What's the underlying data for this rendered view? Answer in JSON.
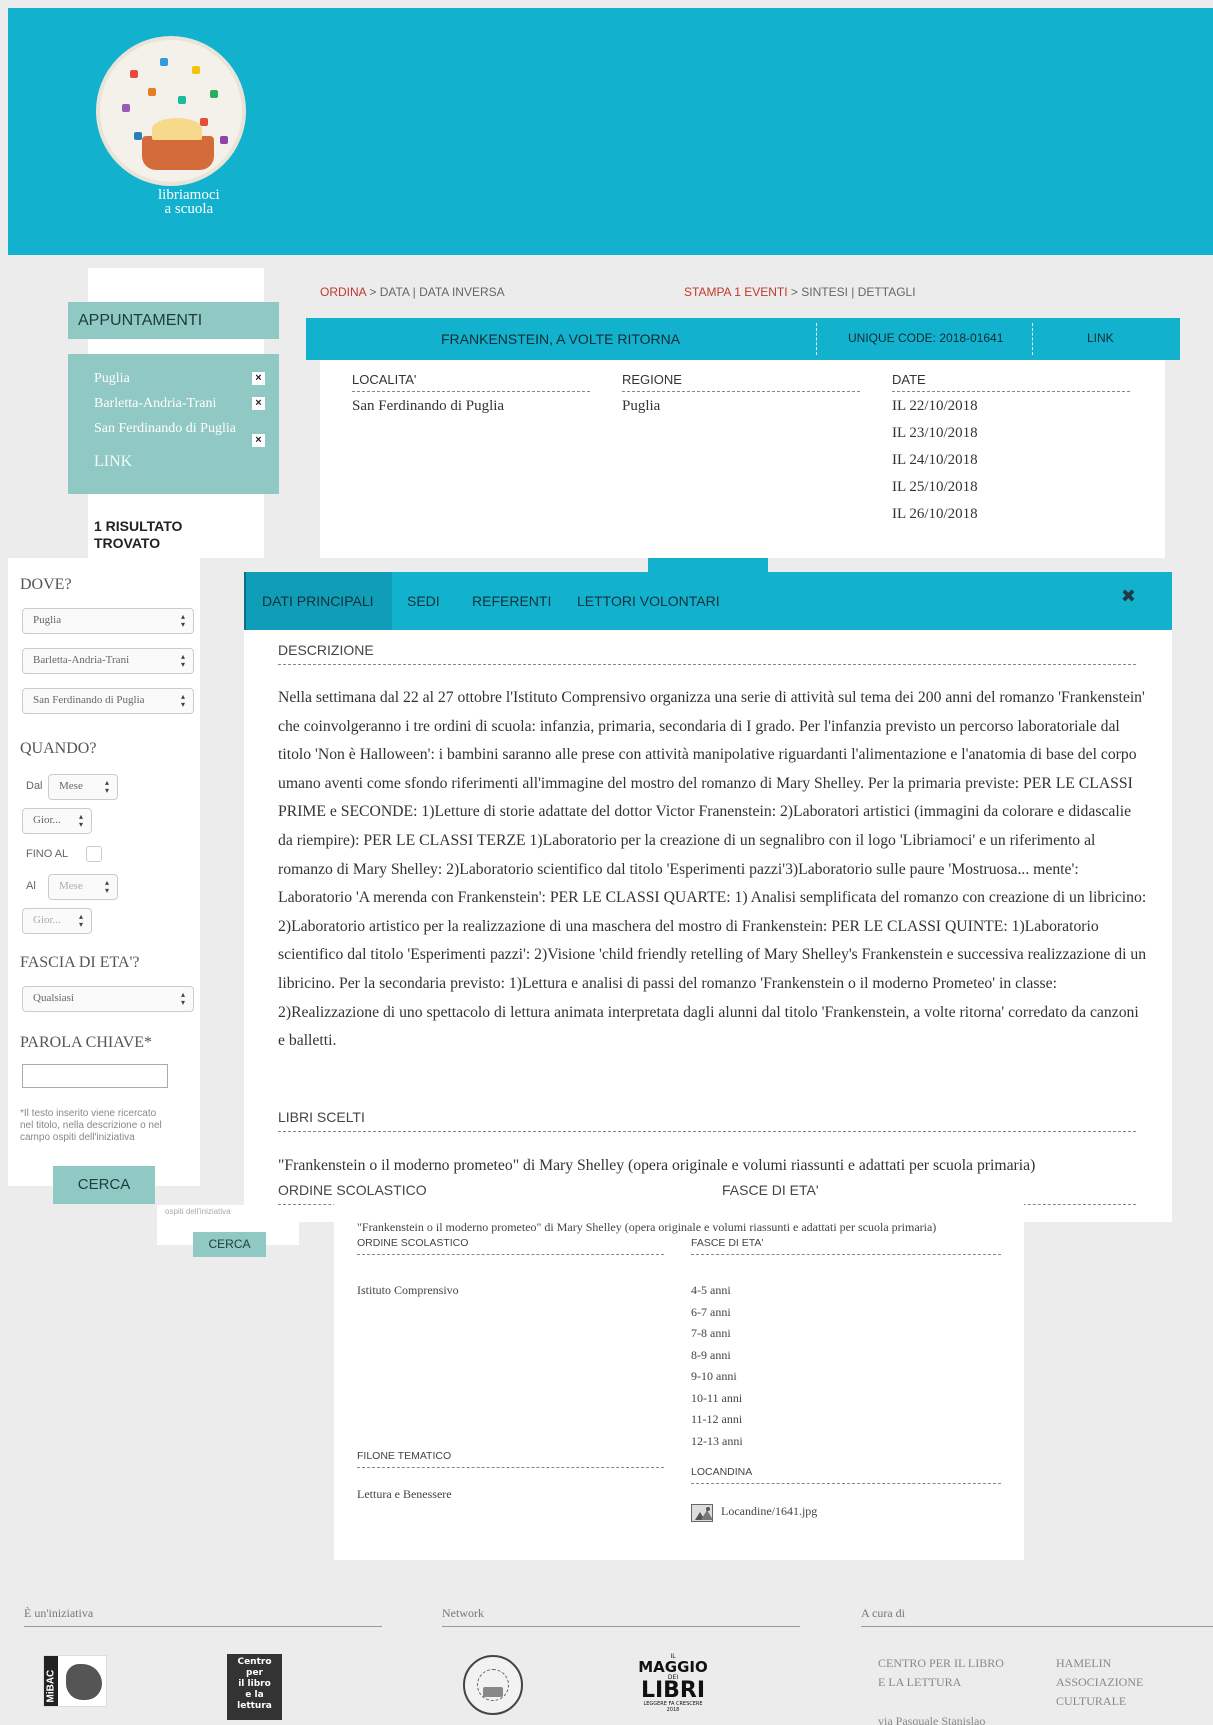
{
  "header": {
    "logo_text_line1": "libriamoci",
    "logo_text_line2": "a scuola"
  },
  "left_panel": {
    "appointments_title": "APPUNTAMENTI",
    "filters": [
      "Puglia",
      "Barletta-Andria-Trani",
      "San Ferdinando di Puglia"
    ],
    "filter_remove_icon": "×",
    "link_label": "LINK",
    "result_line1": "1 RISULTATO",
    "result_line2": "TROVATO"
  },
  "toolbar": {
    "order_label": "ORDINA",
    "order_sep": " > ",
    "order_date": "DATA",
    "order_divider": " | ",
    "order_reverse": "DATA INVERSA",
    "print_label": "STAMPA 1 EVENTI",
    "print_sep": " > ",
    "print_summary": "SINTESI",
    "print_divider": " | ",
    "print_details": "DETTAGLI"
  },
  "event": {
    "title": "FRANKENSTEIN, A VOLTE RITORNA",
    "unique_code": "UNIQUE CODE: 2018-01641",
    "link": "LINK",
    "location_header": "LOCALITA'",
    "location_value": "San Ferdinando di Puglia",
    "region_header": "REGIONE",
    "region_value": "Puglia",
    "dates_header": "DATE",
    "dates": [
      "IL 22/10/2018",
      "IL 23/10/2018",
      "IL 24/10/2018",
      "IL 25/10/2018",
      "IL 26/10/2018"
    ]
  },
  "sidebar": {
    "where_title": "DOVE?",
    "region_select": "Puglia",
    "province_select": "Barletta-Andria-Trani",
    "city_select": "San Ferdinando di Puglia",
    "when_title": "QUANDO?",
    "from_label": "Dal",
    "month_placeholder": "Mese",
    "day_placeholder": "Gior...",
    "until_label": "FINO AL",
    "to_label": "Al",
    "month_placeholder_2": "Mese",
    "day_placeholder_2": "Gior...",
    "age_title": "FASCIA DI ETA'?",
    "age_select": "Qualsiasi",
    "keyword_title": "PAROLA CHIAVE*",
    "keyword_note": "*Il testo inserito viene ricercato nel titolo, nella descrizione o nel campo ospiti dell'iniziativa",
    "search_button": "CERCA"
  },
  "detail": {
    "tabs": [
      "DATI PRINCIPALI",
      "SEDI",
      "REFERENTI",
      "LETTORI VOLONTARI"
    ],
    "close_icon": "✖",
    "description_header": "DESCRIZIONE",
    "description": "Nella settimana dal 22 al 27 ottobre l'Istituto Comprensivo organizza una serie di attività sul tema dei 200 anni del romanzo 'Frankenstein' che coinvolgeranno i tre ordini di scuola: infanzia, primaria, secondaria di I grado. Per l'infanzia previsto un percorso laboratoriale dal titolo 'Non è Halloween': i bambini saranno alle prese con attività manipolative riguardanti l'alimentazione e l'anatomia di base del corpo umano aventi come sfondo riferimenti all'immagine del mostro del romanzo di Mary Shelley. Per la primaria previste: PER LE CLASSI PRIME e SECONDE: 1)Letture di storie adattate del dottor Victor Franenstein: 2)Laboratori artistici (immagini da colorare e didascalie da riempire): PER LE CLASSI TERZE 1)Laboratorio per la creazione di un segnalibro con il logo 'Libriamoci' e un riferimento al romanzo di Mary Shelley: 2)Laboratorio scientifico dal titolo 'Esperimenti pazzi'3)Laboratorio sulle paure 'Mostruosa... mente': Laboratorio 'A merenda con Frankenstein': PER LE CLASSI QUARTE: 1) Analisi semplificata del romanzo con creazione di un libricino: 2)Laboratorio artistico per la realizzazione di una maschera del mostro di Frankenstein: PER LE CLASSI QUINTE: 1)Laboratorio scientifico dal titolo 'Esperimenti pazzi': 2)Visione 'child friendly retelling of Mary Shelley's Frankenstein e successiva realizzazione di un libricino. Per la secondaria previsto: 1)Lettura e analisi di passi del romanzo 'Frankenstein o il moderno Prometeo' in classe: 2)Realizzazione di uno spettacolo di lettura animata interpretata dagli alunni dal titolo 'Frankenstein, a volte ritorna' corredato da canzoni e balletti.",
    "books_header": "LIBRI SCELTI",
    "books_value": "\"Frankenstein o il moderno prometeo\" di Mary Shelley (opera originale e volumi riassunti e adattati per scuola primaria)",
    "school_order_header": "ORDINE SCOLASTICO",
    "age_ranges_header": "FASCE DI ETA'"
  },
  "lower": {
    "keyword_note_fragment": "ospiti dell'iniziativa",
    "search_button": "CERCA",
    "books_value": "\"Frankenstein o il moderno prometeo\" di Mary Shelley (opera originale e volumi riassunti e adattati per scuola primaria)",
    "school_order_header": "ORDINE SCOLASTICO",
    "school_order_value": "Istituto Comprensivo",
    "age_ranges_header": "FASCE DI ETA'",
    "age_ranges": [
      "4-5 anni",
      "6-7 anni",
      "7-8 anni",
      "8-9 anni",
      "9-10 anni",
      "10-11 anni",
      "11-12 anni",
      "12-13 anni"
    ],
    "theme_header": "FILONE TEMATICO",
    "theme_value": "Lettura e Benessere",
    "poster_header": "LOCANDINA",
    "poster_file": "Locandine/1641.jpg"
  },
  "footer": {
    "col1_title": "È un'iniziativa",
    "col2_title": "Network",
    "col3_title": "A cura di",
    "mibac_text": "MiBAC",
    "cepell_lines": [
      "Centro",
      "per",
      "il libro",
      "e la",
      "lettura"
    ],
    "maggio_top": "IL",
    "maggio_line1": "MAGGIO",
    "maggio_mid": "DEI",
    "maggio_line2": "LIBRI",
    "maggio_sub": "LEGGERE FA CRESCERE",
    "maggio_year": "2018",
    "org1": "CENTRO PER IL LIBRO E LA LETTURA",
    "org1_addr": "via Pasquale Stanislao",
    "org2": "HAMELIN ASSOCIAZIONE CULTURALE"
  },
  "colors": {
    "cyan": "#12b2cf",
    "teal": "#90c8c3",
    "red": "#c0392b"
  }
}
